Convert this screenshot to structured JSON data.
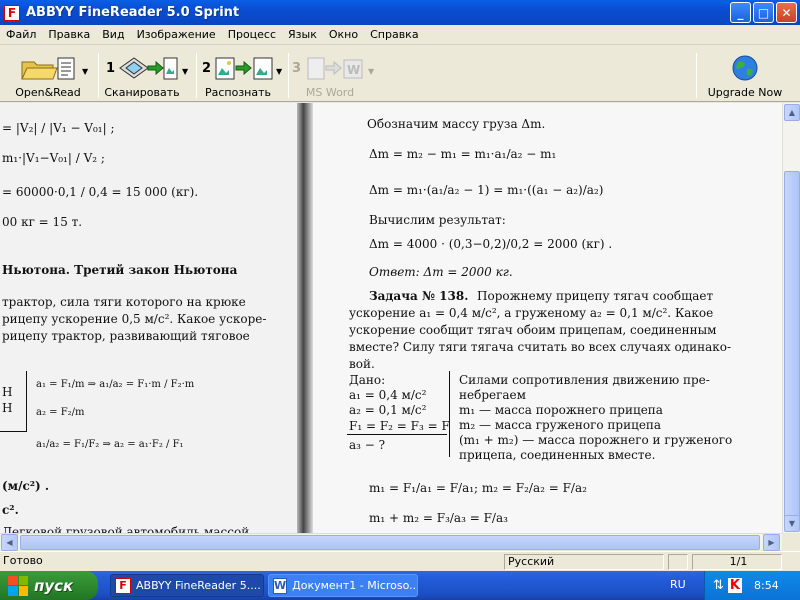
{
  "window": {
    "title": "ABBYY FineReader 5.0 Sprint",
    "icon": "finereader-logo-icon",
    "minimize": "_",
    "maximize": "□",
    "close": "✕"
  },
  "menu": [
    "Файл",
    "Правка",
    "Вид",
    "Изображение",
    "Процесс",
    "Язык",
    "Окно",
    "Справка"
  ],
  "toolbar": {
    "open_read": {
      "label": "Open&Read"
    },
    "scan": {
      "num": "1",
      "label": "Сканировать"
    },
    "recognize": {
      "num": "2",
      "label": "Распознать"
    },
    "msword": {
      "num": "3",
      "label": "MS Word"
    },
    "upgrade": {
      "label": "Upgrade Now"
    }
  },
  "left_page": {
    "lines": [
      "= |V₂| / |V₁ − V₀₁| ;",
      "m₁·|V₁−V₀₁| / V₂ ;",
      "= 60000·0,1 / 0,4 = 15 000 (кг).",
      "00 кг = 15 т.",
      "Ньютона. Третий закон Ньютона",
      "трактор, сила тяги которого на крюке",
      "рицепу ускорение 0,5 м/с². Какое ускоре-",
      "рицепу трактор, развивающий тяговое",
      "a₁ = F₁/m  ⇒  a₁/a₂ = F₁·m / F₂·m",
      "a₂ = F₂/m",
      "a₁/a₂ = F₁/F₂ ⇒ a₂ = a₁·F₂ / F₁",
      "(м/с²) .",
      "с².",
      "Легковой грузовой автомобиль массой"
    ]
  },
  "right_page": {
    "lines": [
      "Обозначим массу груза Δm.",
      "Δm = m₂ − m₁ = m₁·a₁/a₂ − m₁",
      "Δm = m₁·(a₁/a₂ − 1) = m₁·((a₁ − a₂)/a₂)",
      "Вычислим результат:",
      "Δm = 4000 · (0,3−0,2)/0,2 = 2000 (кг) .",
      "Ответ:  Δm = 2000 кг.",
      "Задача № 138.",
      "Порожнему прицепу тягач сообщает",
      "ускорение a₁ = 0,4 м/с², а груженому a₂ = 0,1 м/с². Какое",
      "ускорение сообщит тягач обоим прицепам, соединенным",
      "вместе? Силу тяги тягача считать во всех случаях одинако-",
      "вой.",
      "Дано:",
      "a₁ = 0,4 м/с²",
      "a₂ = 0,1 м/с²",
      "F₁ = F₂ = F₃ = F",
      "a₃ − ?",
      "Силами сопротивления движению пре-",
      "небрегаем",
      "m₁ — масса порожнего прицепа",
      "m₂ — масса груженого прицепа",
      "(m₁ + m₂) — масса порожнего и груженого",
      "прицепа, соединенных вместе.",
      "m₁ = F₁/a₁ = F/a₁;     m₂ = F₂/a₂ = F/a₂",
      "m₁ + m₂ = F₃/a₃ = F/a₃"
    ]
  },
  "status": {
    "left": "Готово",
    "language": "Русский",
    "page": "1/1"
  },
  "taskbar": {
    "start": "пуск",
    "tasks": [
      {
        "label": "ABBYY FineReader 5....",
        "icon": "finereader-logo-icon"
      },
      {
        "label": "Документ1 - Microso...",
        "icon": "word-document-icon"
      }
    ],
    "lang": "RU",
    "clock": "8:54"
  }
}
